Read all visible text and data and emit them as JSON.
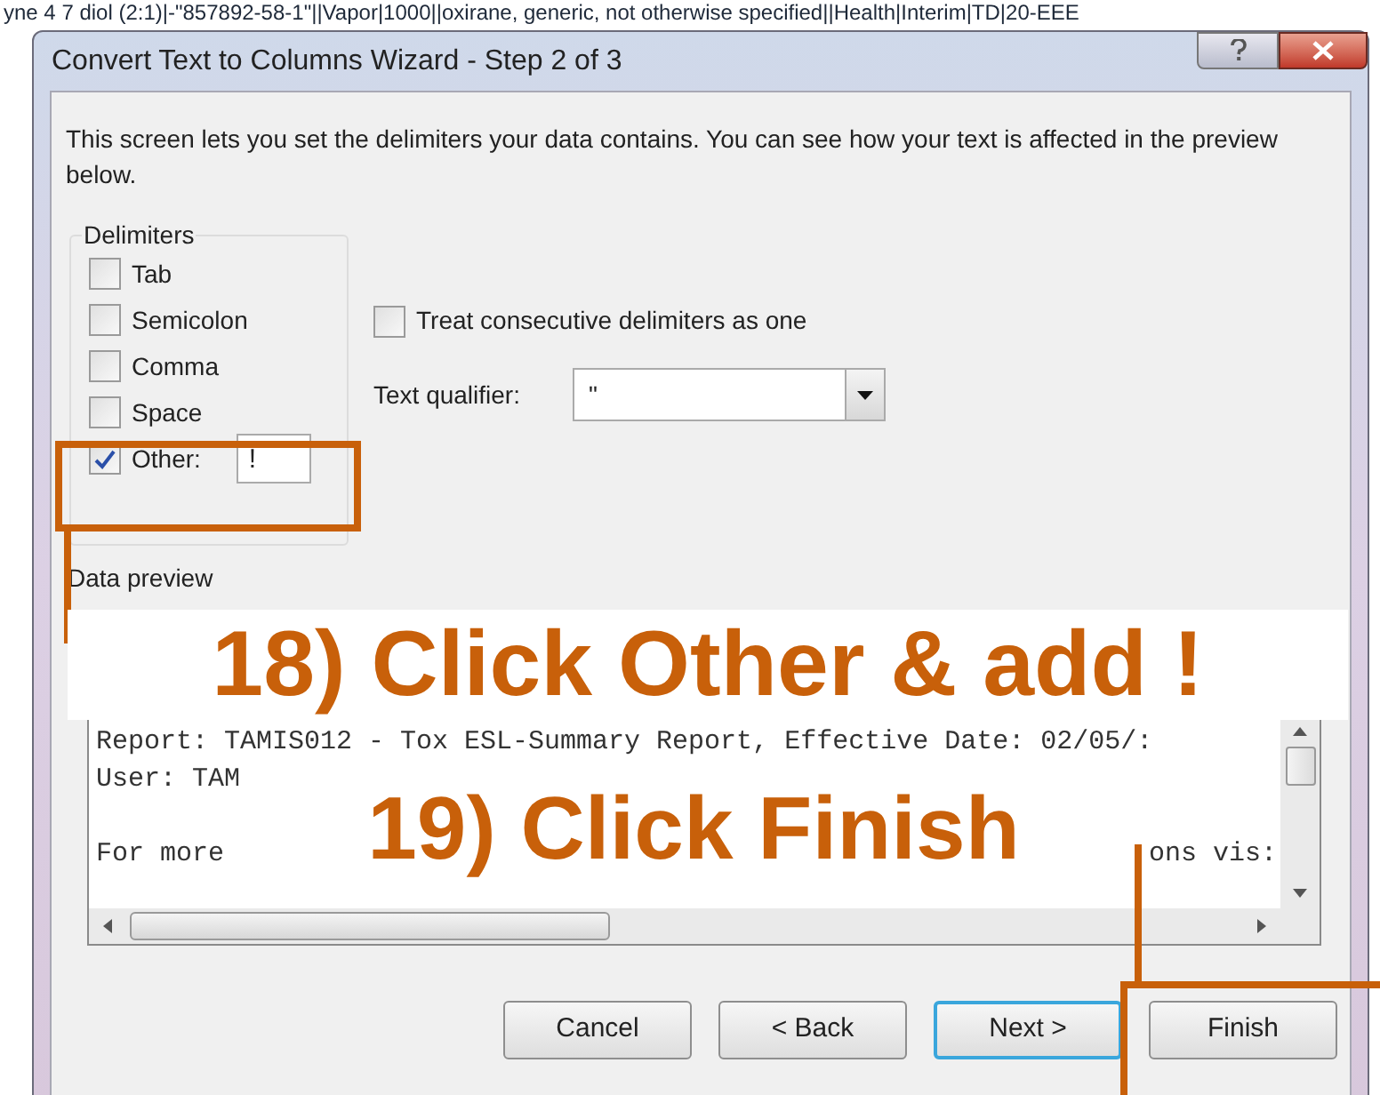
{
  "background_text": "yne 4 7 diol (2:1)|-\"857892-58-1\"||Vapor|1000||oxirane, generic, not otherwise specified||Health|Interim|TD|20-EEE",
  "window": {
    "title": "Convert Text to Columns Wizard - Step 2 of 3"
  },
  "description": "This screen lets you set the delimiters your data contains.  You can see how your text is affected in the preview below.",
  "delimiters": {
    "title": "Delimiters",
    "options": [
      {
        "label": "Tab",
        "checked": false
      },
      {
        "label": "Semicolon",
        "checked": false
      },
      {
        "label": "Comma",
        "checked": false
      },
      {
        "label": "Space",
        "checked": false
      },
      {
        "label": "Other:",
        "checked": true,
        "value": "!"
      }
    ]
  },
  "treat_consecutive": {
    "label": "Treat consecutive delimiters as one",
    "checked": false
  },
  "text_qualifier": {
    "label": "Text qualifier:",
    "value": "\""
  },
  "data_preview": {
    "label": "Data preview",
    "lines": [
      {
        "text": "Report: TAMIS012 - Tox ESL-Summary Report, Effective Date: 02/05/:"
      },
      {
        "text": "User: TAM"
      },
      {
        "text": "For more",
        "tail": "ons vis:"
      }
    ]
  },
  "buttons": [
    {
      "label": "Cancel",
      "default": false
    },
    {
      "label": "< Back",
      "default": false
    },
    {
      "label": "Next >",
      "default": true
    },
    {
      "label": "Finish",
      "default": false
    }
  ],
  "annotations": [
    {
      "text": "18) Click Other & add !"
    },
    {
      "text": "19) Click Finish"
    }
  ]
}
